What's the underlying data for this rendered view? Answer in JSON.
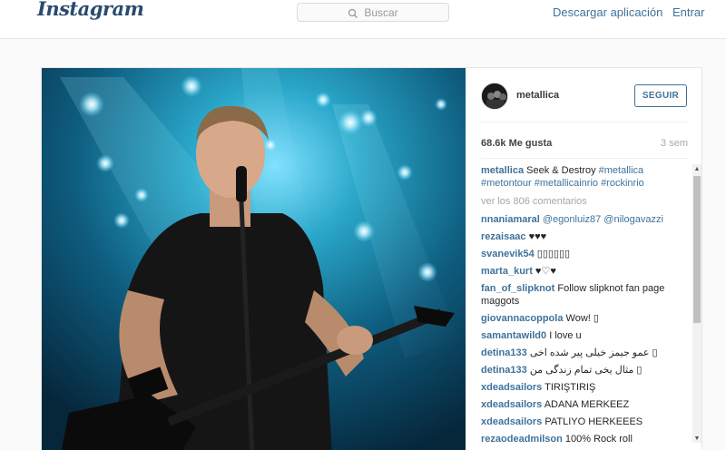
{
  "topbar": {
    "logo": "Instagram",
    "search_placeholder": "Buscar",
    "download_link": "Descargar aplicación",
    "login_link": "Entrar"
  },
  "post": {
    "username": "metallica",
    "follow_label": "SEGUIR",
    "likes": "68.6k Me gusta",
    "time_ago": "3 sem",
    "caption": {
      "user": "metallica",
      "text": "Seek & Destroy",
      "hashtags": "#metallica #metontour #metallicainrio #rockinrio"
    },
    "view_comments": "ver los 806 comentarios",
    "comments": [
      {
        "user": "nnaniamaral",
        "text": "",
        "mention": "@egonluiz87 @nilogavazzi"
      },
      {
        "user": "rezaisaac",
        "text": "♥♥♥",
        "mention": ""
      },
      {
        "user": "svanevik54",
        "text": "▯▯▯▯▯▯",
        "mention": ""
      },
      {
        "user": "marta_kurt",
        "text": "♥♡♥",
        "mention": ""
      },
      {
        "user": "fan_of_slipknot",
        "text": "Follow slipknot fan page maggots",
        "mention": ""
      },
      {
        "user": "giovannacoppola",
        "text": "Wow! ▯",
        "mention": ""
      },
      {
        "user": "samantawild0",
        "text": "I love u",
        "mention": ""
      },
      {
        "user": "detina133",
        "text": "عمو جیمز خیلی پیر شده اخی ▯",
        "mention": ""
      },
      {
        "user": "detina133",
        "text": "مثال یخی تمام زندگی من ▯",
        "mention": ""
      },
      {
        "user": "xdeadsailors",
        "text": "TIRIŞTIRIŞ",
        "mention": ""
      },
      {
        "user": "xdeadsailors",
        "text": "ADANA MERKEEZ",
        "mention": ""
      },
      {
        "user": "xdeadsailors",
        "text": "PATLIYO HERKEEES",
        "mention": ""
      },
      {
        "user": "rezaodeadmilson",
        "text": "100% Rock roll",
        "mention": ""
      }
    ]
  },
  "icons": {
    "search": "search-icon",
    "scroll_up": "scroll-up-arrow-icon",
    "scroll_down": "scroll-down-arrow-icon"
  },
  "colors": {
    "link_blue": "#3f729b",
    "muted_gray": "#a5a7aa",
    "border": "#e6e6e6"
  }
}
